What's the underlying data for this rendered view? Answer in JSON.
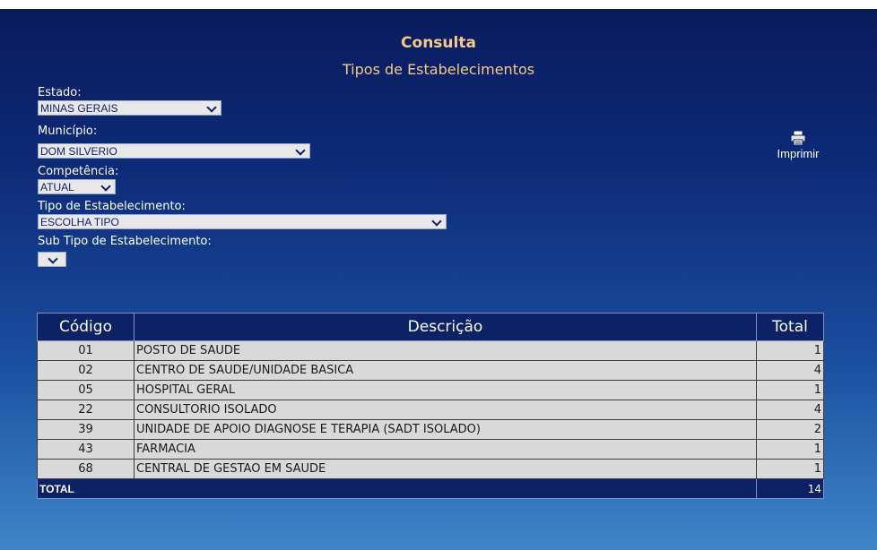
{
  "header": {
    "title": "Consulta",
    "subtitle": "Tipos de Estabelecimentos"
  },
  "form": {
    "estado": {
      "label": "Estado:",
      "value": "MINAS GERAIS"
    },
    "municipio": {
      "label": "Município:",
      "value": "DOM SILVERIO"
    },
    "competencia": {
      "label": "Competência:",
      "value": "ATUAL"
    },
    "tipo": {
      "label": "Tipo de Estabelecimento:",
      "value": "ESCOLHA TIPO"
    },
    "subtipo": {
      "label": "Sub Tipo de Estabelecimento:",
      "value": ""
    }
  },
  "print": {
    "label": "Imprimir",
    "icon": "printer-icon"
  },
  "table": {
    "headers": [
      "Código",
      "Descrição",
      "Total"
    ],
    "rows": [
      {
        "code": "01",
        "desc": "POSTO DE SAUDE",
        "total": "1"
      },
      {
        "code": "02",
        "desc": "CENTRO DE SAUDE/UNIDADE BASICA",
        "total": "4"
      },
      {
        "code": "05",
        "desc": "HOSPITAL GERAL",
        "total": "1"
      },
      {
        "code": "22",
        "desc": "CONSULTORIO ISOLADO",
        "total": "4"
      },
      {
        "code": "39",
        "desc": "UNIDADE DE APOIO DIAGNOSE E TERAPIA (SADT ISOLADO)",
        "total": "2"
      },
      {
        "code": "43",
        "desc": "FARMACIA",
        "total": "1"
      },
      {
        "code": "68",
        "desc": "CENTRAL DE GESTAO EM SAUDE",
        "total": "1"
      }
    ],
    "footer": {
      "label": "TOTAL",
      "total": "14"
    }
  },
  "colors": {
    "background_top": "#0a1a5a",
    "background_bottom": "#3f86c9",
    "title": "#f5c98a",
    "table_header": "#0d2266",
    "row_bg": "#d9d9d9"
  }
}
